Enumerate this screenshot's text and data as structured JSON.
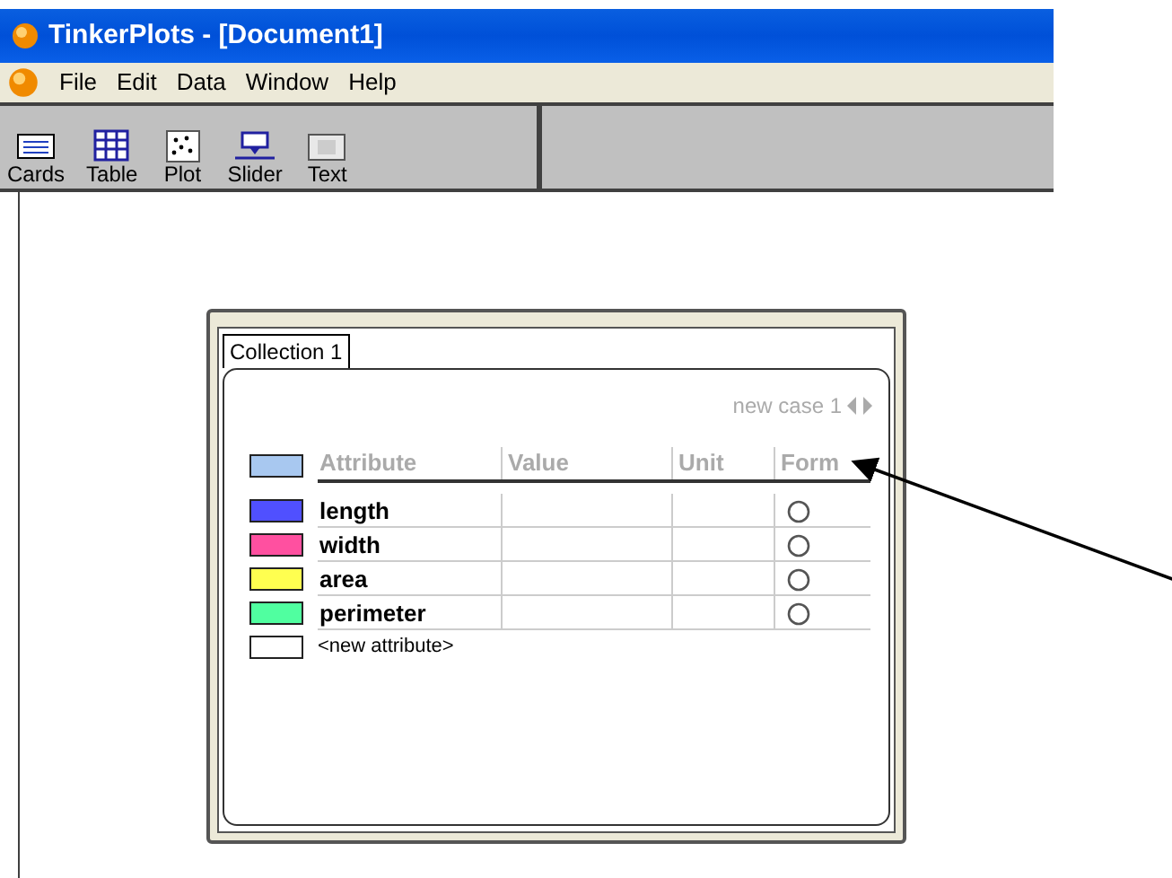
{
  "window": {
    "title": "TinkerPlots - [Document1]"
  },
  "menu": [
    "File",
    "Edit",
    "Data",
    "Window",
    "Help"
  ],
  "toolbar": [
    {
      "label": "Cards",
      "kind": "cards"
    },
    {
      "label": "Table",
      "kind": "table"
    },
    {
      "label": "Plot",
      "kind": "plot"
    },
    {
      "label": "Slider",
      "kind": "slider"
    },
    {
      "label": "Text",
      "kind": "text"
    }
  ],
  "card": {
    "tab": "Collection 1",
    "case_label": "new case 1",
    "columns": [
      "Attribute",
      "Value",
      "Unit",
      "Form"
    ],
    "header": {
      "color": "#a8c8f0"
    },
    "rows": [
      {
        "kind": "attribute",
        "name": "length",
        "color": "#5050ff"
      },
      {
        "kind": "attribute",
        "name": "width",
        "color": "#ff50a0"
      },
      {
        "kind": "attribute",
        "name": "area",
        "color": "#ffff50"
      },
      {
        "kind": "attribute",
        "name": "perimeter",
        "color": "#50ffa0"
      },
      {
        "kind": "new",
        "name": "<new attribute>",
        "color": "#ffffff"
      }
    ]
  }
}
